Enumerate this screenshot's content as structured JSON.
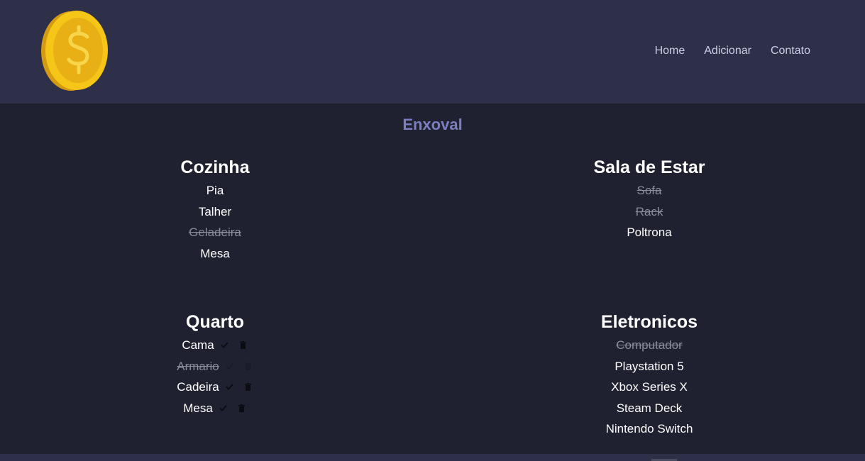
{
  "header": {
    "logo": "coin-dollar-icon",
    "nav": [
      "Home",
      "Adicionar",
      "Contato"
    ]
  },
  "page": {
    "title": "Enxoval"
  },
  "sections": [
    {
      "title": "Cozinha",
      "items": [
        {
          "label": "Pia",
          "done": false
        },
        {
          "label": "Talher",
          "done": false
        },
        {
          "label": "Geladeira",
          "done": true
        },
        {
          "label": "Mesa",
          "done": false
        }
      ]
    },
    {
      "title": "Sala de Estar",
      "items": [
        {
          "label": "Sofa",
          "done": true
        },
        {
          "label": "Rack",
          "done": true
        },
        {
          "label": "Poltrona",
          "done": false
        }
      ]
    },
    {
      "title": "Quarto",
      "show_actions": true,
      "items": [
        {
          "label": "Cama",
          "done": false
        },
        {
          "label": "Armario",
          "done": true
        },
        {
          "label": "Cadeira",
          "done": false
        },
        {
          "label": "Mesa",
          "done": false
        }
      ]
    },
    {
      "title": "Eletronicos",
      "items": [
        {
          "label": "Computador",
          "done": true
        },
        {
          "label": "Playstation 5",
          "done": false
        },
        {
          "label": "Xbox Series X",
          "done": false
        },
        {
          "label": "Steam Deck",
          "done": false
        },
        {
          "label": "Nintendo Switch",
          "done": false
        }
      ]
    }
  ],
  "icons": {
    "check": "check-icon",
    "delete": "trash-icon"
  },
  "colors": {
    "header_bg": "#2e2f48",
    "page_bg": "#1f2130",
    "title": "#7a7fbf",
    "coin": "#f5c518"
  }
}
